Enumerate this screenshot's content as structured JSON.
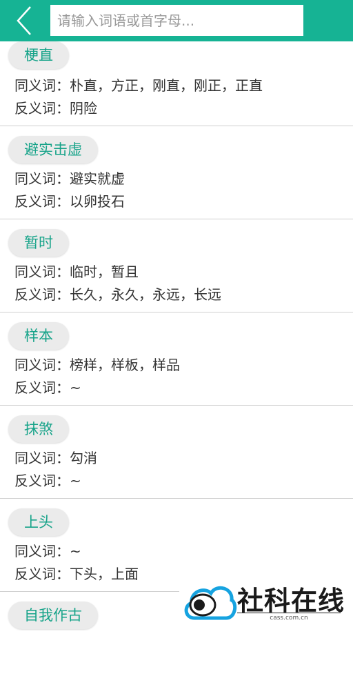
{
  "header": {
    "search_placeholder": "请输入词语或首字母...",
    "accent_color": "#16b394",
    "back_icon": "chevron-left-icon"
  },
  "entries": [
    {
      "word": "梗直",
      "synonyms": "同义词：朴直，方正，刚直，刚正，正直",
      "antonyms": "反义词：阴险"
    },
    {
      "word": "避实击虚",
      "synonyms": "同义词：避实就虚",
      "antonyms": "反义词：以卵投石"
    },
    {
      "word": "暂时",
      "synonyms": "同义词：临时，暂且",
      "antonyms": "反义词：长久，永久，永远，长远"
    },
    {
      "word": "样本",
      "synonyms": "同义词：榜样，样板，样品",
      "antonyms": "反义词：~"
    },
    {
      "word": "抹煞",
      "synonyms": "同义词：勾消",
      "antonyms": "反义词：~"
    },
    {
      "word": "上头",
      "synonyms": "同义词：~",
      "antonyms": "反义词：下头，上面"
    },
    {
      "word": "自我作古"
    }
  ],
  "watermark": {
    "name": "社科在线",
    "domain": "cass.com.cn"
  }
}
